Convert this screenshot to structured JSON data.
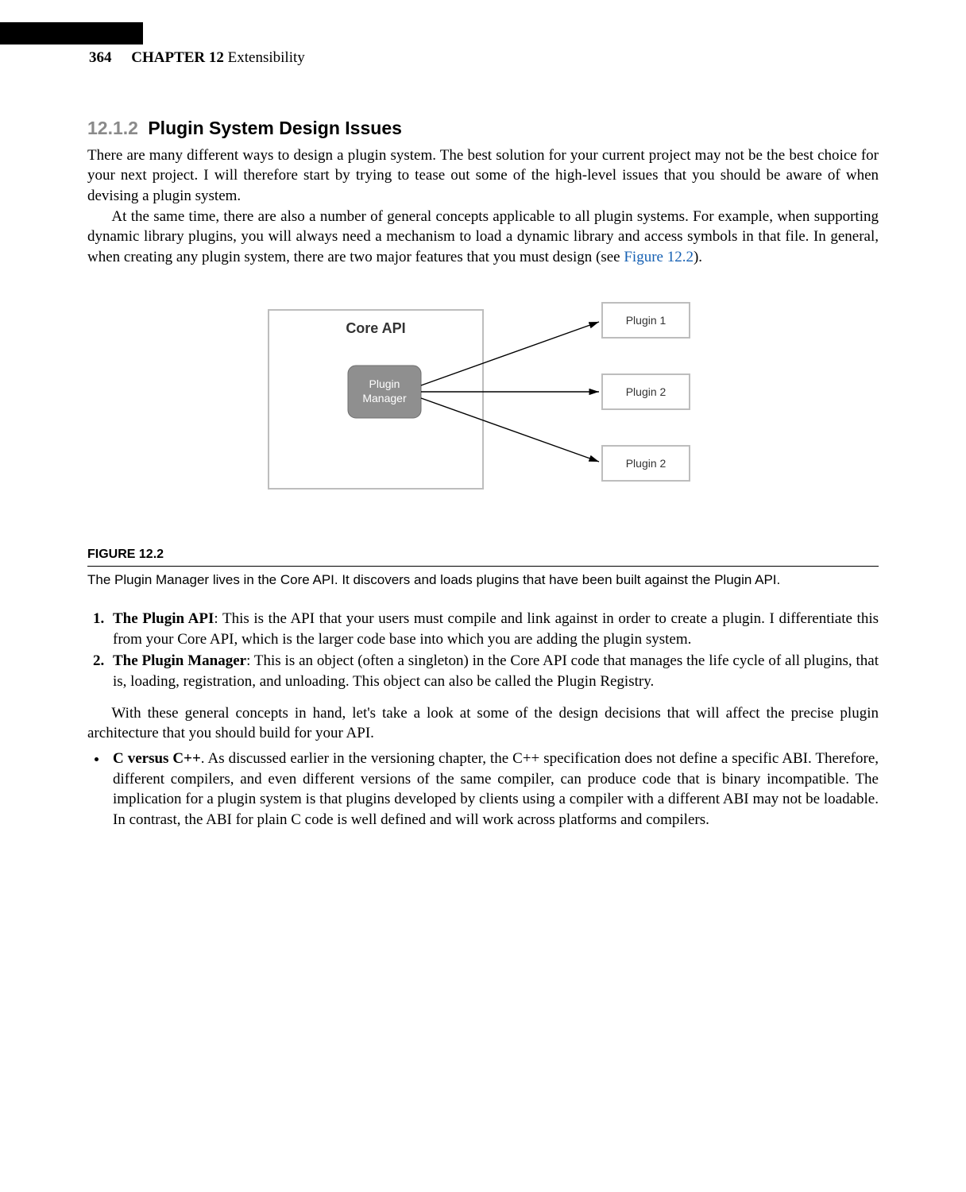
{
  "header": {
    "page_number": "364",
    "chapter_label": "CHAPTER 12",
    "chapter_title": "Extensibility"
  },
  "section": {
    "number": "12.1.2",
    "title": "Plugin System Design Issues"
  },
  "paragraphs": {
    "p1": "There are many different ways to design a plugin system. The best solution for your current project may not be the best choice for your next project. I will therefore start by trying to tease out some of the high-level issues that you should be aware of when devising a plugin system.",
    "p2a": "At the same time, there are also a number of general concepts applicable to all plugin systems. For example, when supporting dynamic library plugins, you will always need a mechanism to load a dynamic library and access symbols in that file. In general, when creating any plugin system, there are two major features that you must design (see ",
    "p2_link": "Figure 12.2",
    "p2b": ")."
  },
  "figure": {
    "label": "FIGURE 12.2",
    "caption": "The Plugin Manager lives in the Core API. It discovers and loads plugins that have been built against the Plugin API.",
    "diagram": {
      "core_api_label": "Core API",
      "plugin_manager_label_l1": "Plugin",
      "plugin_manager_label_l2": "Manager",
      "plugin_box_1": "Plugin 1",
      "plugin_box_2": "Plugin 2",
      "plugin_box_3": "Plugin 2"
    }
  },
  "list1": {
    "item1_term": "The Plugin API",
    "item1_rest": ": This is the API that your users must compile and link against in order to create a plugin. I differentiate this from your Core API, which is the larger code base into which you are adding the plugin system.",
    "item2_term": "The Plugin Manager",
    "item2_rest": ": This is an object (often a singleton) in the Core API code that manages the life cycle of all plugins, that is, loading, registration, and unloading. This object can also be called the Plugin Registry."
  },
  "paragraphs2": {
    "p3": "With these general concepts in hand, let's take a look at some of the design decisions that will affect the precise plugin architecture that you should build for your API."
  },
  "bullets": {
    "b1_term": "C versus C",
    "b1_plus": "++",
    "b1_rest1": ". As discussed earlier in the versioning chapter, the C",
    "b1_plus2": "++",
    "b1_rest2": " specification does not define a specific ABI. Therefore, different compilers, and even different versions of the same compiler, can produce code that is binary incompatible. The implication for a plugin system is that plugins developed by clients using a compiler with a different ABI may not be loadable. In contrast, the ABI for plain C code is well defined and will work across platforms and compilers."
  }
}
